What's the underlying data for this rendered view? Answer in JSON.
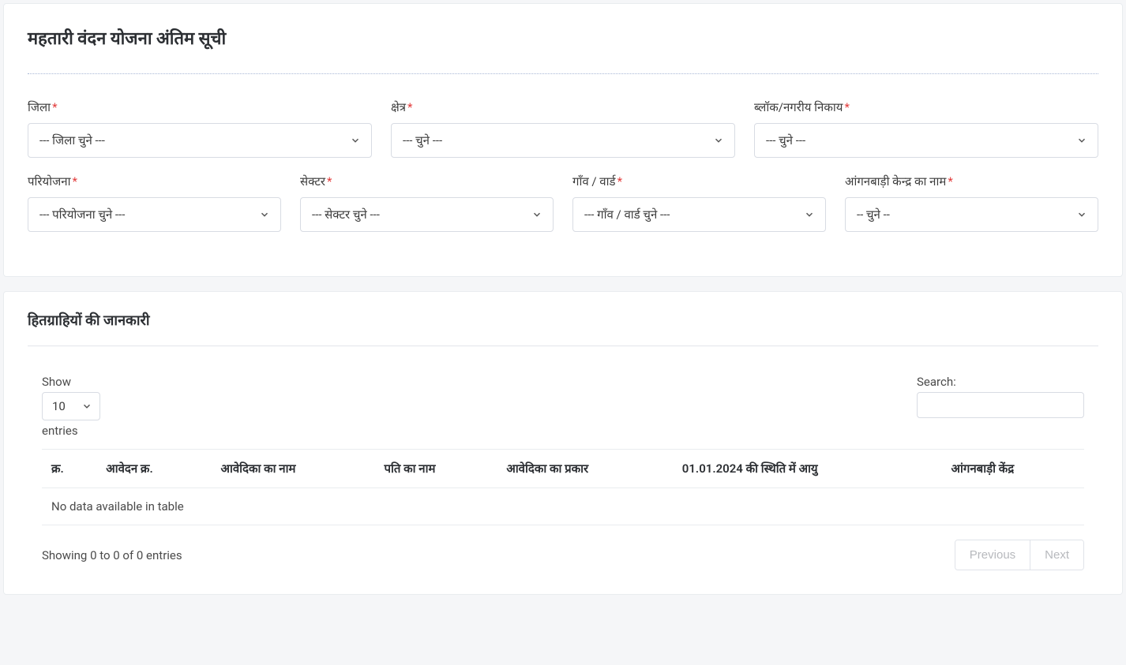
{
  "page": {
    "title": "महतारी वंदन योजना अंतिम सूची"
  },
  "filters": {
    "district": {
      "label": "जिला",
      "placeholder": "--- जिला चुने ---"
    },
    "area": {
      "label": "क्षेत्र",
      "placeholder": "--- चुने ---"
    },
    "block": {
      "label": "ब्लॉक/नगरीय निकाय",
      "placeholder": "--- चुने ---"
    },
    "project": {
      "label": "परियोजना",
      "placeholder": "--- परियोजना चुने ---"
    },
    "sector": {
      "label": "सेक्टर",
      "placeholder": "--- सेक्टर चुने ---"
    },
    "village": {
      "label": "गाँव / वार्ड",
      "placeholder": "--- गाँव / वार्ड चुने ---"
    },
    "anganwadi": {
      "label": "आंगनबाड़ी केन्द्र का नाम",
      "placeholder": "-- चुने --"
    }
  },
  "results": {
    "section_title": "हितग्राहियों की जानकारी",
    "show_label": "Show",
    "entries_label": "entries",
    "page_size": "10",
    "search_label": "Search:",
    "columns": {
      "sno": "क्र.",
      "app_no": "आवेदन क्र.",
      "applicant_name": "आवेदिका का नाम",
      "father_name": "पति का नाम",
      "applicant_type": "आवेदिका का प्रकार",
      "age": "01.01.2024 की स्थिति में आयु",
      "center": "आंगनबाड़ी केंद्र"
    },
    "empty_text": "No data available in table",
    "info_text": "Showing 0 to 0 of 0 entries",
    "prev_label": "Previous",
    "next_label": "Next"
  }
}
